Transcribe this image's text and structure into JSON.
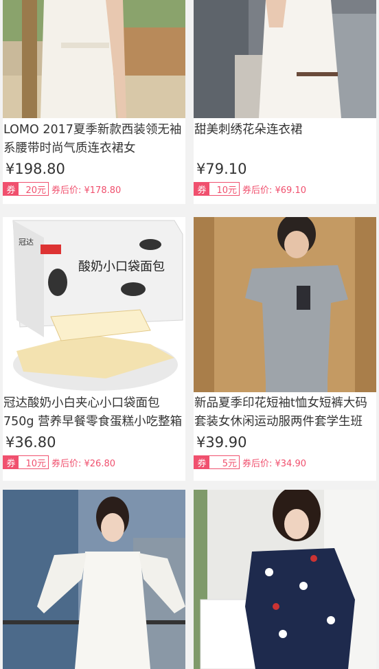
{
  "products": [
    {
      "title": "LOMO 2017夏季新款西装领无袖系腰带时尚气质连衣裙女",
      "price": "¥198.80",
      "coupon_tag": "券",
      "coupon_amount": "20元",
      "after_price": "券后价: ¥178.80",
      "image_icon": "white-dress-photo"
    },
    {
      "title": "甜美刺绣花朵连衣裙",
      "price": "¥79.10",
      "coupon_tag": "券",
      "coupon_amount": "10元",
      "after_price": "券后价: ¥69.10",
      "image_icon": "embroidered-dress-photo"
    },
    {
      "title": "冠达酸奶小白夹心小口袋面包750g 营养早餐零食蛋糕小吃整箱",
      "price": "¥36.80",
      "coupon_tag": "券",
      "coupon_amount": "10元",
      "after_price": "券后价: ¥26.80",
      "image_icon": "bread-box-photo",
      "image_brand": "冠达",
      "image_text": "酸奶小口袋面包"
    },
    {
      "title": "新品夏季印花短袖t恤女短裤大码套装女休闲运动服两件套学生班",
      "price": "¥39.90",
      "coupon_tag": "券",
      "coupon_amount": "5元",
      "after_price": "券后价: ¥34.90",
      "image_icon": "grey-tshirt-set-photo"
    },
    {
      "image_icon": "white-offshoulder-dress-photo"
    },
    {
      "image_icon": "navy-print-dress-photo"
    }
  ]
}
